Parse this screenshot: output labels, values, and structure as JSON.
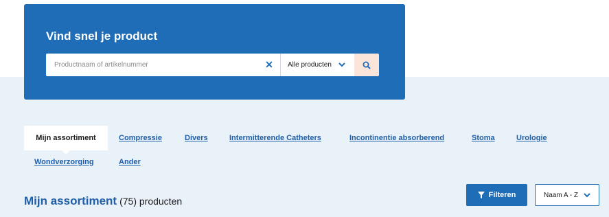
{
  "search": {
    "title": "Vind snel je product",
    "placeholder": "Productnaam of artikelnummer",
    "value": "",
    "category_selected": "Alle producten"
  },
  "tabs": {
    "active": "Mijn assortiment",
    "items": [
      "Compressie",
      "Divers",
      "Intermitterende Catheters",
      "Incontinentie absorberend",
      "Stoma",
      "Urologie",
      "Wondverzorging",
      "Ander"
    ]
  },
  "results": {
    "title": "Mijn assortiment",
    "count_text": "(75) producten"
  },
  "toolbar": {
    "filter_label": "Filteren",
    "sort_selected": "Naam A - Z"
  },
  "colors": {
    "primary": "#1f6db7",
    "link": "#1f5fa8",
    "search_button_bg": "#fbe4da",
    "section_bg": "#e9f1f9"
  }
}
